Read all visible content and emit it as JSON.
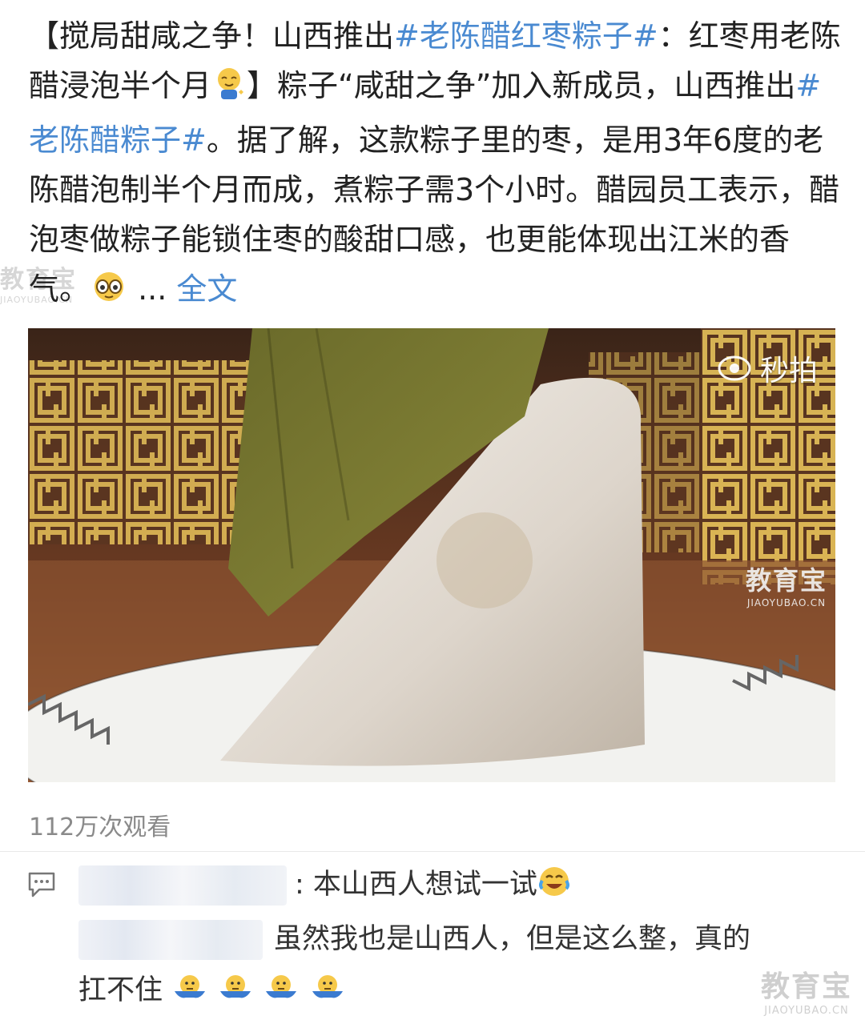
{
  "post": {
    "p1": "【搅局甜咸之争！山西推出",
    "tag1": "#老陈醋红枣粽子#",
    "p2": "：红枣用老陈醋浸泡半个月",
    "p3": "】粽子“咸甜之争”加入新成员，山西推出",
    "tag2": "#老陈醋粽子#",
    "p4": "。据了解，这款粽子里的枣，是用3年6度的老陈醋泡制半个月而成，煮粽子需3个小时。醋园员工表示，醋泡枣做粽子能锁住枣的酸甜口感，也更能体现出江米的香气。",
    "ellipsis": " ... ",
    "full_text_link": "全文"
  },
  "video": {
    "source_label": "秒拍"
  },
  "views": "112万次观看",
  "comments": {
    "c1_text": ": 本山西人想试一试",
    "c2_text": "虽然我也是山西人，但是这么整，真的",
    "c3_text": "扛不住"
  },
  "watermarks": {
    "cn": "教育宝",
    "en": "JIAOYUBAO.CN"
  },
  "icons": {
    "emoji_1": "sleepy-smile-icon",
    "emoji_2": "shy-face-icon",
    "emoji_3": "laugh-cry-icon",
    "emoji_4": "shrug-icon",
    "comment": "comment-icon",
    "video_source": "eye-logo-icon"
  },
  "colors": {
    "hashtag": "#4a8ad1",
    "text": "#222222",
    "muted": "#8a8a8a"
  }
}
